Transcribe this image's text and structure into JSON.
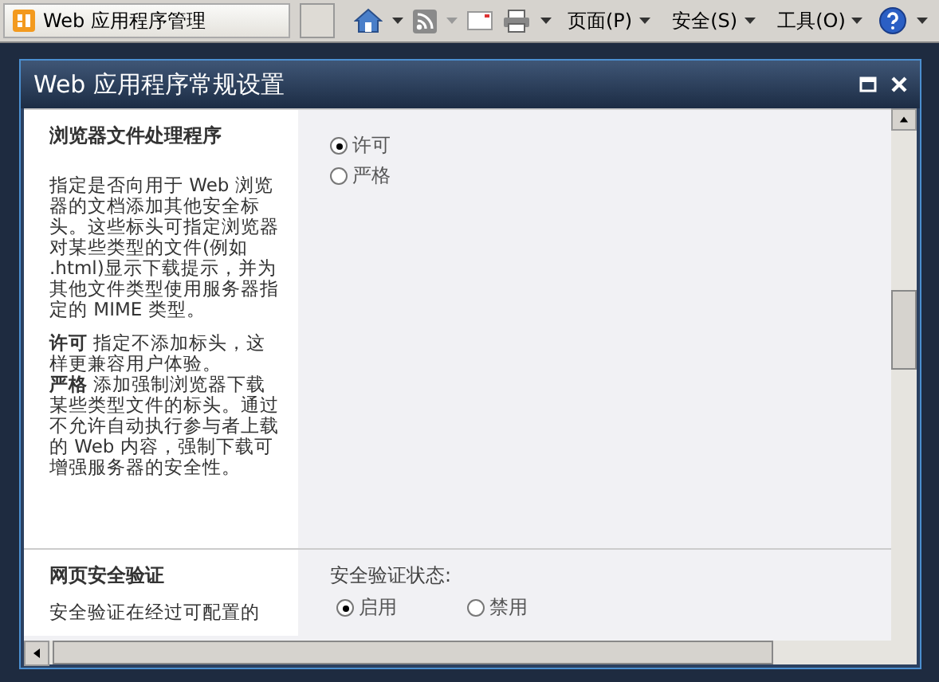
{
  "browser_tab": {
    "title": "Web 应用程序管理"
  },
  "toolbar": {
    "menus": [
      {
        "label": "页面(P)"
      },
      {
        "label": "安全(S)"
      },
      {
        "label": "工具(O)"
      }
    ]
  },
  "dialog": {
    "title": "Web 应用程序常规设置",
    "sections": [
      {
        "heading": "浏览器文件处理程序",
        "paragraphs": [
          "指定是否向用于 Web 浏览器的文档添加其他安全标头。这些标头可指定浏览器对某些类型的文件(例如 .html)显示下载提示，并为其他文件类型使用服务器指定的 MIME 类型。",
          "**许可** 指定不添加标头，这样更兼容用户体验。",
          "**严格** 添加强制浏览器下载某些类型文件的标头。通过不允许自动执行参与者上载的 Web 内容，强制下载可增强服务器的安全性。"
        ],
        "options": [
          {
            "label": "许可",
            "selected": true
          },
          {
            "label": "严格",
            "selected": false
          }
        ]
      },
      {
        "heading": "网页安全验证",
        "paragraphs": [
          "安全验证在经过可配置的"
        ],
        "field_label": "安全验证状态:",
        "options": [
          {
            "label": "启用",
            "selected": true
          },
          {
            "label": "禁用",
            "selected": false
          }
        ]
      }
    ]
  }
}
